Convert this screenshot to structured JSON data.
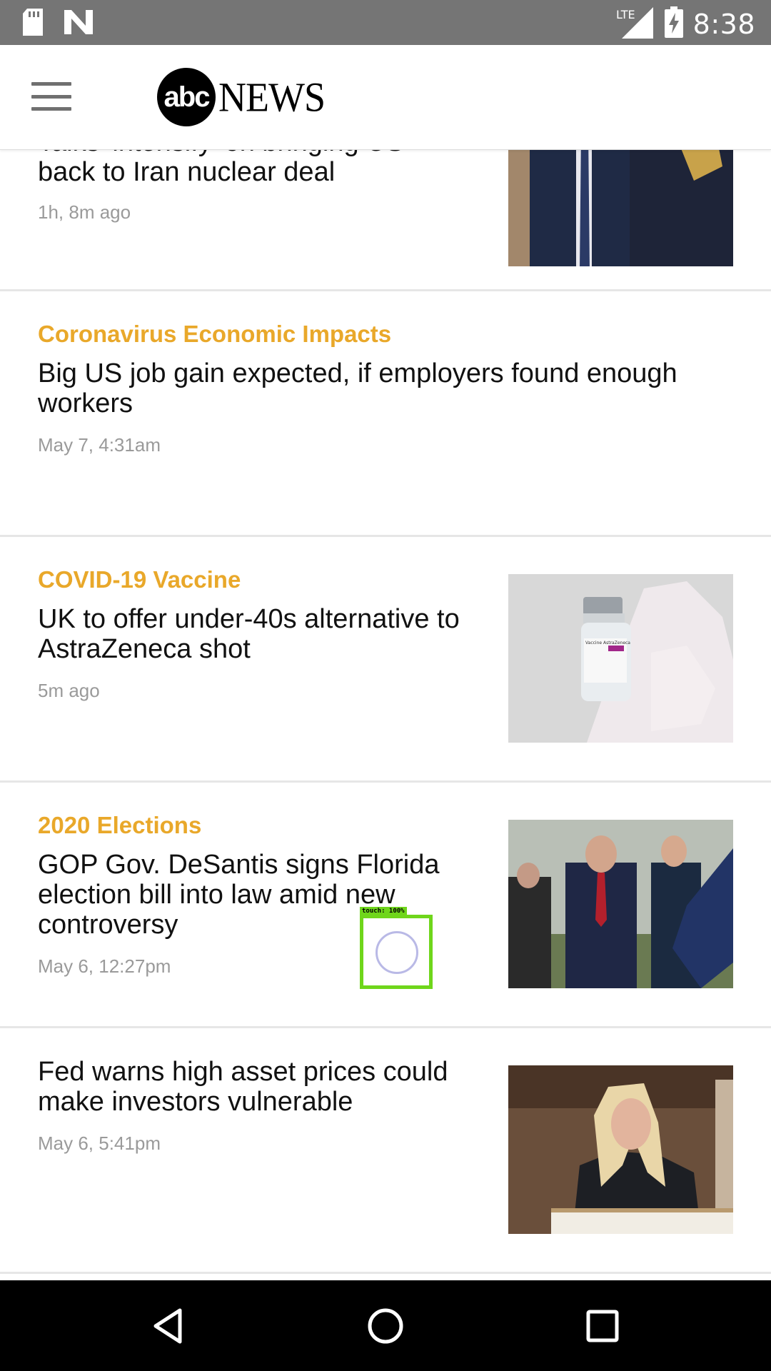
{
  "status_bar": {
    "time": "8:38",
    "network": "LTE",
    "icons": [
      "sd-card-icon",
      "n-logo-icon",
      "lte-signal-icon",
      "battery-charging-icon"
    ]
  },
  "header": {
    "logo_circle_text": "abc",
    "logo_word": "NEWS",
    "menu_icon": "hamburger-menu-icon"
  },
  "stories": [
    {
      "category": "",
      "headline_partial": "Talks 'intensify' on bringing US",
      "headline": "back to Iran nuclear deal",
      "time": "1h, 8m ago",
      "has_image": true
    },
    {
      "category": "Coronavirus Economic Impacts",
      "headline": "Big US job gain expected, if employers found enough workers",
      "time": "May 7, 4:31am",
      "has_image": false
    },
    {
      "category": "COVID-19 Vaccine",
      "headline": "UK to offer under-40s alternative to AstraZeneca shot",
      "time": "5m ago",
      "has_image": true,
      "image_text": "Vaccine AstraZeneca"
    },
    {
      "category": "2020 Elections",
      "headline": "GOP Gov. DeSantis signs Florida election bill into law amid new controversy",
      "time": "May 6, 12:27pm",
      "has_image": true
    },
    {
      "category": "",
      "headline": "Fed warns high asset prices could make investors vulnerable",
      "time": "May 6, 5:41pm",
      "has_image": true
    }
  ],
  "touch_indicator": {
    "label": "touch: 100%"
  },
  "nav": {
    "back": "back-icon",
    "home": "home-icon",
    "recents": "recents-icon"
  },
  "colors": {
    "category": "#e9a82a",
    "status_bar": "#757575",
    "nav_bar": "#000000"
  }
}
